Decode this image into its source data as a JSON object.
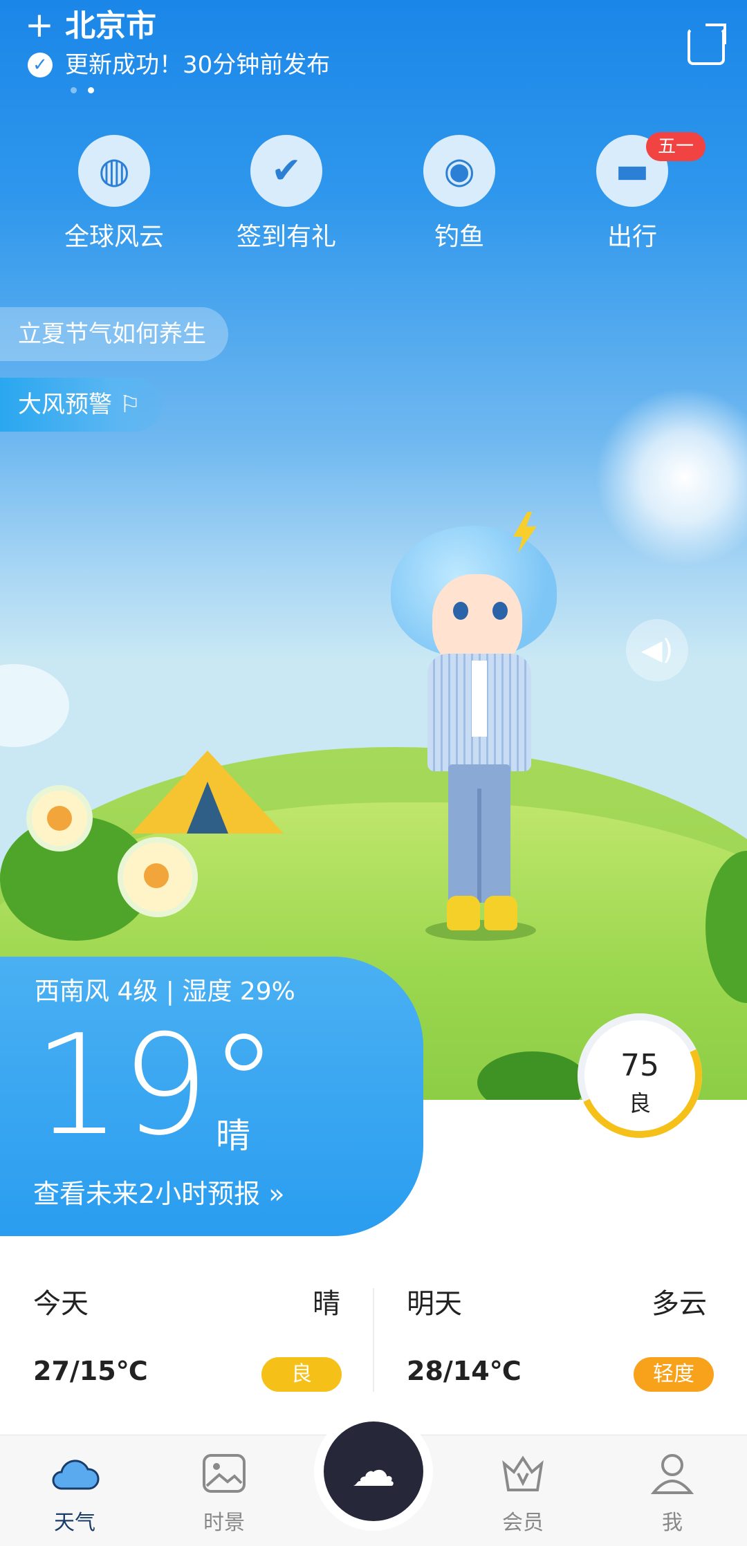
{
  "header": {
    "add_icon": "plus-icon",
    "city": "北京市",
    "update_status": "更新成功！30分钟前发布"
  },
  "quick_actions": [
    {
      "label": "全球风云",
      "icon": "globe-icon"
    },
    {
      "label": "签到有礼",
      "icon": "gift-calendar-icon"
    },
    {
      "label": "钓鱼",
      "icon": "fish-icon"
    },
    {
      "label": "出行",
      "icon": "car-icon",
      "badge": "五一"
    }
  ],
  "tips": {
    "solar_term": "立夏节气如何养生",
    "warning": "大风预警 ⚐"
  },
  "current": {
    "wind_humidity": "西南风 4级 | 湿度 29%",
    "temperature": "19°",
    "condition": "晴",
    "forecast_link": "查看未来2小时预报 »"
  },
  "aqi": {
    "value": "75",
    "level": "良",
    "fill_fraction": 0.25,
    "color": "#f5c017"
  },
  "daily": {
    "today": {
      "label": "今天",
      "condition": "晴",
      "range": "27/15℃",
      "quality": "良",
      "quality_color": "#f5c017"
    },
    "tomorrow": {
      "label": "明天",
      "condition": "多云",
      "range": "28/14℃",
      "quality": "轻度",
      "quality_color": "#f7a21a"
    }
  },
  "tabbar": [
    {
      "label": "天气",
      "icon": "cloud-icon",
      "active": true
    },
    {
      "label": "时景",
      "icon": "image-icon",
      "active": false
    },
    {
      "label": "",
      "icon": "wind-cloud-icon",
      "active": false
    },
    {
      "label": "会员",
      "icon": "crown-icon",
      "active": false
    },
    {
      "label": "我",
      "icon": "person-icon",
      "active": false
    }
  ],
  "colors": {
    "accent": "#1a86e8",
    "card": "#2a9df0",
    "tab_active": "#1a86e8"
  }
}
